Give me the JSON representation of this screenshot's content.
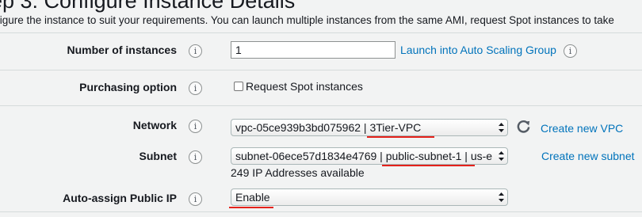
{
  "header": {
    "title": "ep 3: Configure Instance Details",
    "subtitle": "figure the instance to suit your requirements. You can launch multiple instances from the same AMI, request Spot instances to take"
  },
  "info_glyph": "i",
  "fields": {
    "instances": {
      "label": "Number of instances",
      "value": "1",
      "asg_link": "Launch into Auto Scaling Group"
    },
    "purchasing": {
      "label": "Purchasing option",
      "spot_label": "Request Spot instances",
      "spot_checked": false
    },
    "network": {
      "label": "Network",
      "value": "vpc-05ce939b3bd075962 | 3Tier-VPC",
      "create_link": "Create new VPC"
    },
    "subnet": {
      "label": "Subnet",
      "value": "subnet-06ece57d1834e4769 | public-subnet-1 | us-e",
      "create_link": "Create new subnet",
      "helper": "249 IP Addresses available"
    },
    "public_ip": {
      "label": "Auto-assign Public IP",
      "value": "Enable"
    }
  },
  "colors": {
    "link": "#0073bb",
    "highlight_underline": "#e4211a",
    "page_background": "#f2f3f3"
  }
}
